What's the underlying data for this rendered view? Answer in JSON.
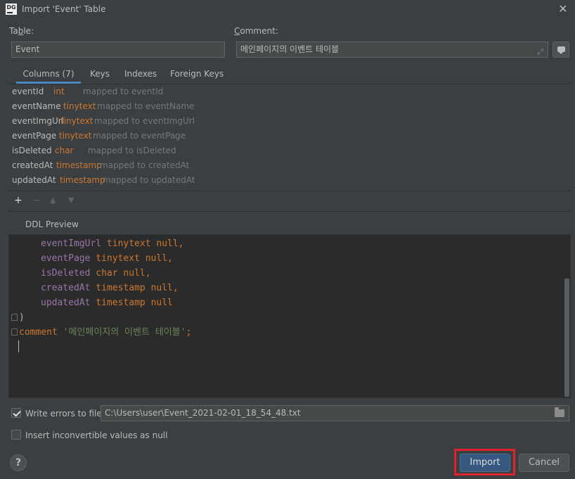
{
  "window": {
    "app_icon_text": "DG",
    "title": "Import 'Event' Table"
  },
  "form": {
    "table_label_prefix": "Ta",
    "table_label_mnemonic": "b",
    "table_label_suffix": "le:",
    "table_value": "Event",
    "comment_label_mnemonic": "C",
    "comment_label_suffix": "omment:",
    "comment_value": "메인페이지의 이벤트 테이블"
  },
  "tabs": [
    {
      "label": "Columns (7)",
      "active": true
    },
    {
      "label": "Keys",
      "active": false
    },
    {
      "label": "Indexes",
      "active": false
    },
    {
      "label": "Foreign Keys",
      "active": false
    }
  ],
  "columns": [
    {
      "name": "eventId",
      "type": "int",
      "mapping": "mapped to eventId"
    },
    {
      "name": "eventName",
      "type": "tinytext",
      "mapping": "mapped to eventName"
    },
    {
      "name": "eventImgUrl",
      "type": "tinytext",
      "mapping": "mapped to eventImgUrl"
    },
    {
      "name": "eventPage",
      "type": "tinytext",
      "mapping": "mapped to eventPage"
    },
    {
      "name": "isDeleted",
      "type": "char",
      "mapping": "mapped to isDeleted"
    },
    {
      "name": "createdAt",
      "type": "timestamp",
      "mapping": "mapped to createdAt"
    },
    {
      "name": "updatedAt",
      "type": "timestamp",
      "mapping": "mapped to updatedAt"
    }
  ],
  "toolbar": {
    "add": "+",
    "remove": "−",
    "up": "▲",
    "down": "▼"
  },
  "ddl": {
    "label": "DDL Preview",
    "lines": [
      {
        "field": "eventImgUrl",
        "type": "tinytext",
        "suffix": "null,"
      },
      {
        "field": "eventPage",
        "type": "tinytext",
        "suffix": "null,"
      },
      {
        "field": "isDeleted",
        "type": "char",
        "suffix": "null,"
      },
      {
        "field": "createdAt",
        "type": "timestamp",
        "suffix": "null,"
      },
      {
        "field": "updatedAt",
        "type": "timestamp",
        "suffix": "null"
      }
    ],
    "close_paren": ")",
    "comment_keyword": "comment",
    "comment_string": "'메인페이지의 이벤트 테이블'",
    "terminator": ";"
  },
  "options": {
    "write_errors_label": "Write errors to file:",
    "write_errors_checked": true,
    "error_file_path": "C:\\Users\\user\\Event_2021-02-01_18_54_48.txt",
    "insert_null_label": "Insert inconvertible values as null",
    "insert_null_checked": false
  },
  "buttons": {
    "help": "?",
    "import": "Import",
    "cancel": "Cancel"
  },
  "colors": {
    "background": "#3c3f41",
    "editor_bg": "#2b2b2b",
    "type_orange": "#cc7832",
    "field_purple": "#9876aa",
    "string_green": "#6a8759",
    "primary_button": "#365880",
    "highlight_red": "#e0232b"
  }
}
